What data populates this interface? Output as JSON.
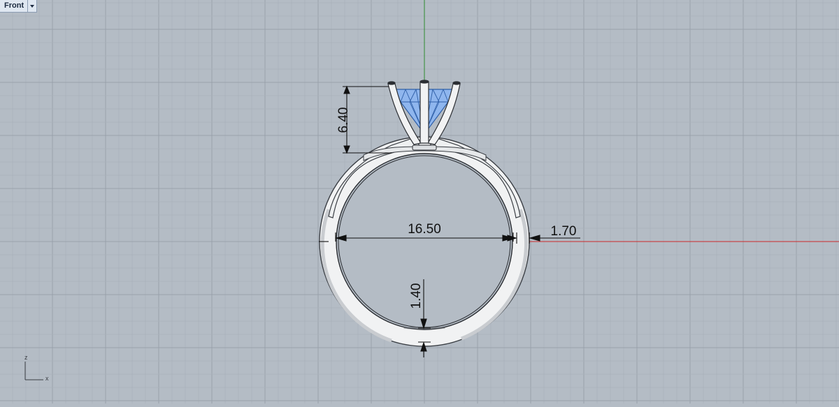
{
  "viewport": {
    "title": "Front",
    "background": "#b4bcc5"
  },
  "dimensions": {
    "setting_height": "6.40",
    "inner_diameter": "16.50",
    "band_width": "1.70",
    "band_thickness": "1.40"
  },
  "axes": {
    "z_label": "z",
    "x_label": "x",
    "x_axis_color": "#cc2a2a",
    "y_axis_color": "#2e8b2e"
  },
  "colors": {
    "gem": "#8fb6ee",
    "gem_line": "#2f5fa8",
    "metal": "#f0f1f2",
    "grid_minor": "#a8b0ba",
    "grid_major": "#9aa2ac"
  },
  "icons": {
    "view_menu": "chevron-down-icon",
    "axis_widget": "axis-icon"
  }
}
